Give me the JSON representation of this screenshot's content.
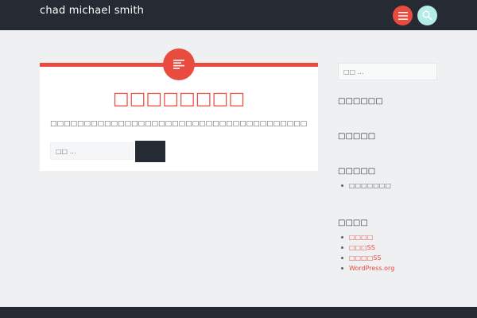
{
  "header": {
    "site_title": "chad michael smith",
    "menu_icon": "hamburger-menu-icon",
    "search_icon": "search-icon"
  },
  "main": {
    "post_icon": "article-icon",
    "title": "□□□□□□□□",
    "message": "□□□□□□□□□□□□□□□□□□□□□□□□□□□□□□□□□□□□□□",
    "search": {
      "placeholder": "□□ …",
      "submit_label": ""
    }
  },
  "sidebar": {
    "search_placeholder": "□□ …",
    "widgets": [
      {
        "title": "□□□□□□",
        "items": []
      },
      {
        "title": "□□□□□",
        "items": []
      },
      {
        "title": "□□□□□",
        "items": [
          {
            "label": "□□□□□□□"
          }
        ]
      },
      {
        "title": "□□□□",
        "items": [
          {
            "label": "□□□□"
          },
          {
            "label": "□□□SS"
          },
          {
            "label": "□□□□SS"
          },
          {
            "label": "WordPress.org"
          }
        ]
      }
    ]
  },
  "colors": {
    "accent": "#ea4b3f",
    "header_bg": "#262b33",
    "search_button": "#b5ece8",
    "page_bg": "#eef0f2"
  }
}
